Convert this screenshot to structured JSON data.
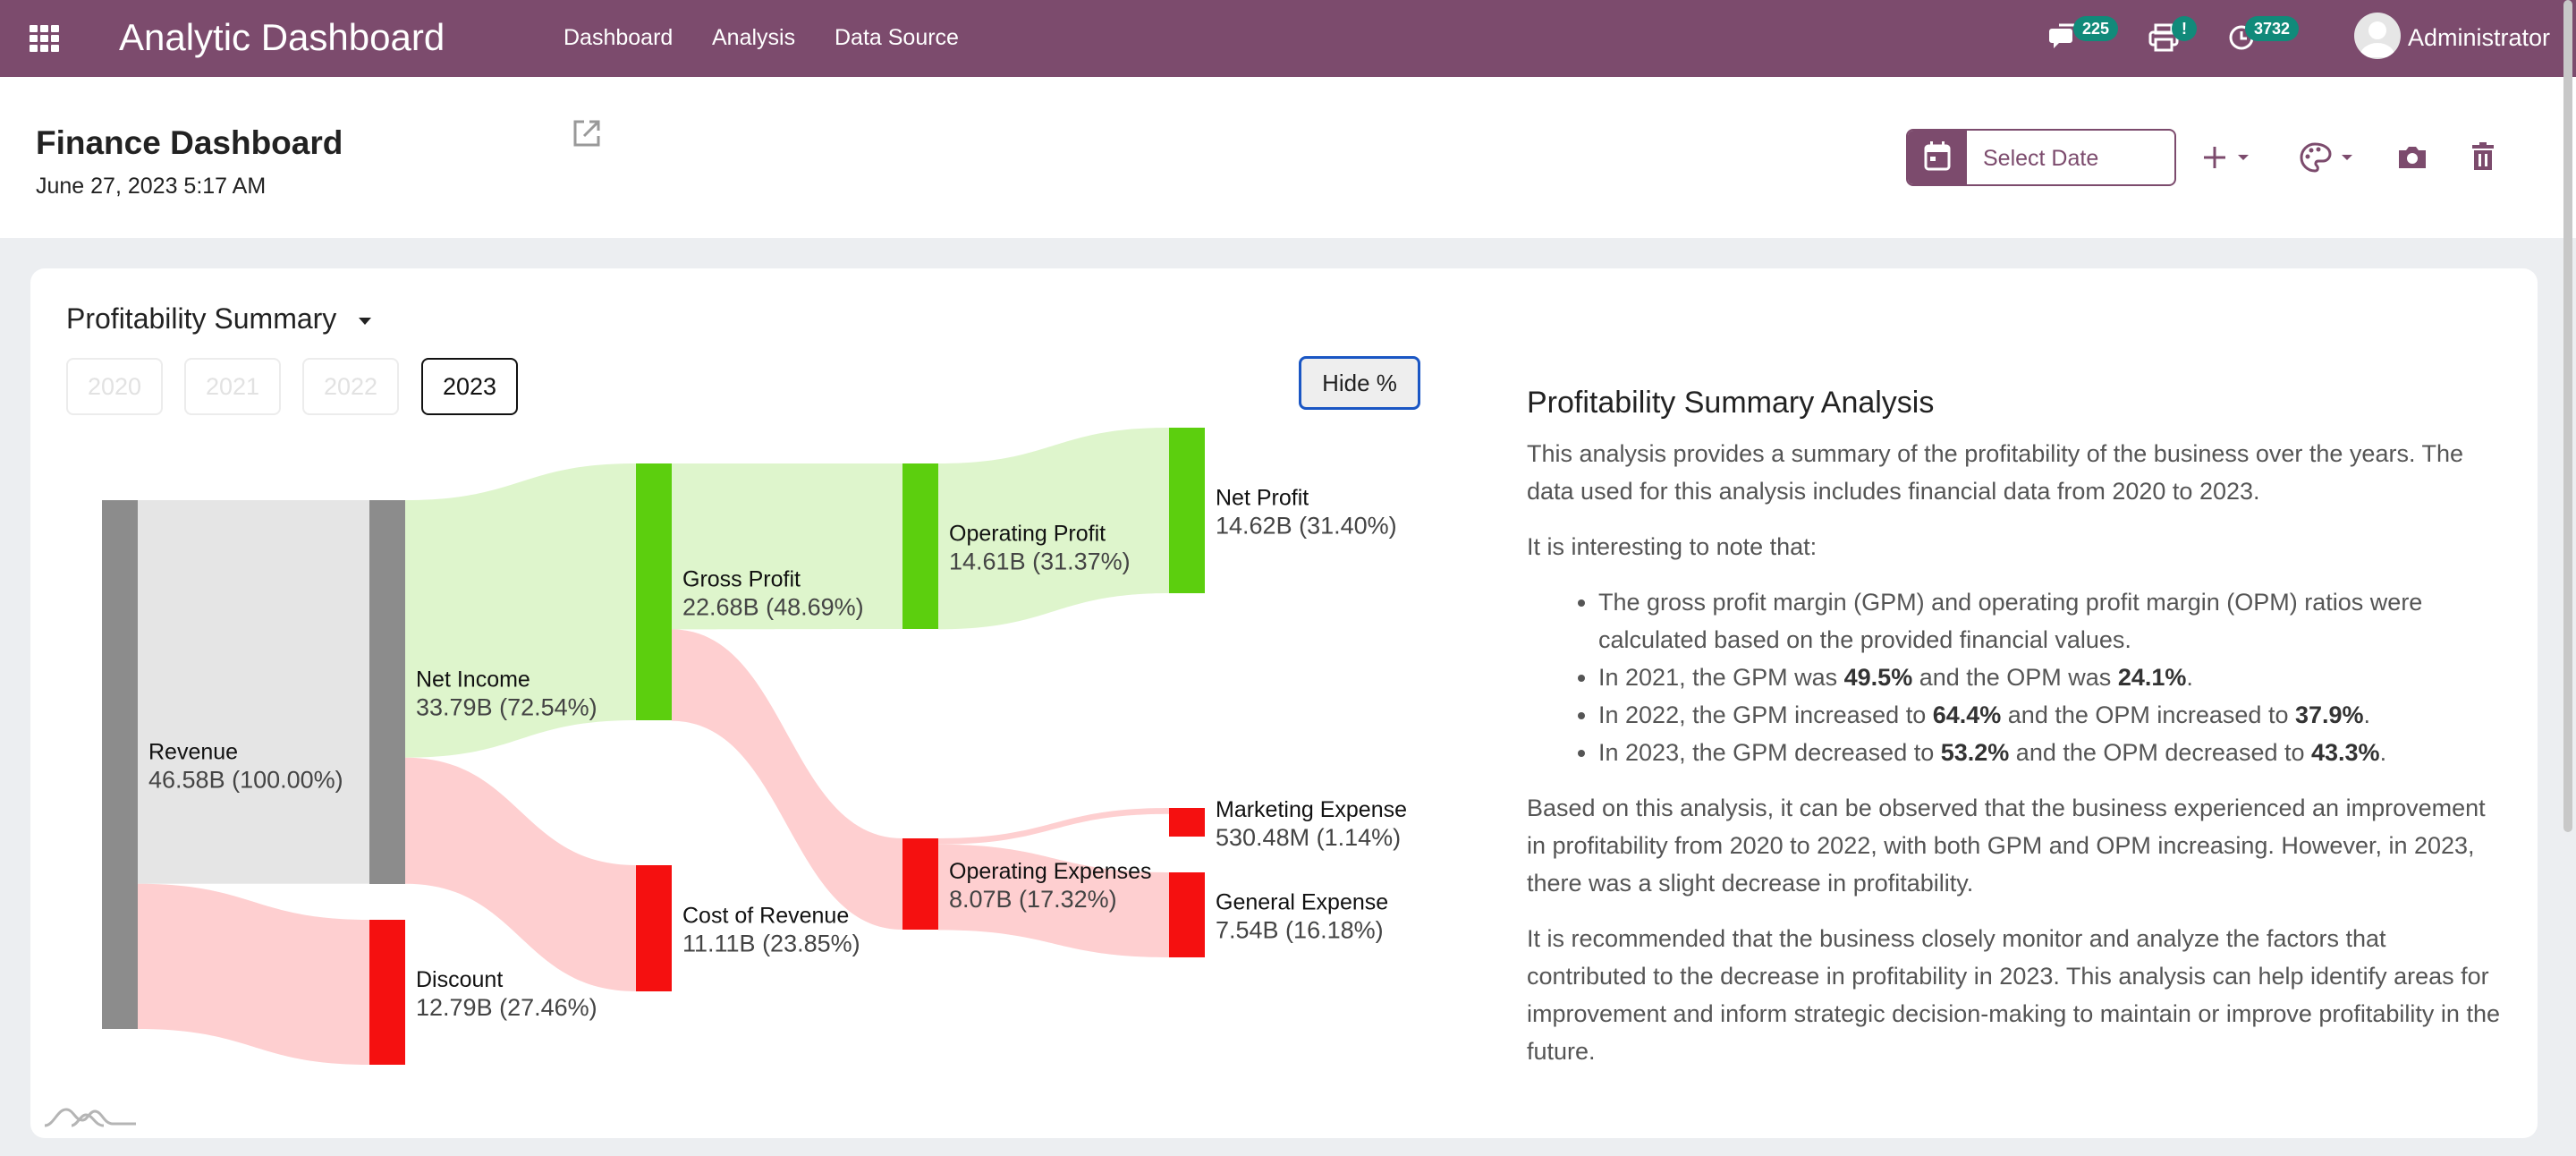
{
  "nav": {
    "title": "Analytic Dashboard",
    "items": [
      {
        "label": "Dashboard"
      },
      {
        "label": "Analysis"
      },
      {
        "label": "Data Source"
      }
    ],
    "badges": {
      "messages": "225",
      "printer": "!",
      "activity": "3732"
    },
    "user": "Administrator",
    "icons": [
      "apps-grid-icon",
      "chat-icon",
      "printer-icon",
      "clock-icon"
    ]
  },
  "header": {
    "title": "Finance Dashboard",
    "date": "June 27, 2023 5:17 AM",
    "date_placeholder": "Select Date",
    "icons": [
      "external-link-icon",
      "calendar-icon",
      "plus-icon",
      "palette-icon",
      "camera-icon",
      "trash-icon"
    ]
  },
  "card": {
    "selector": "Profitability Summary",
    "years": [
      {
        "label": "2020",
        "active": false
      },
      {
        "label": "2021",
        "active": false
      },
      {
        "label": "2022",
        "active": false
      },
      {
        "label": "2023",
        "active": true
      }
    ],
    "hide_label": "Hide %"
  },
  "chart_data": {
    "type": "sankey",
    "colors": {
      "neutral": "#8c8c8c",
      "profit": "#5ccf0e",
      "loss": "#f51010",
      "profit_link": "#def5cc",
      "loss_link": "#fecfd0",
      "neutral_link": "#e5e5e5"
    },
    "nodes": [
      {
        "id": "revenue",
        "label": "Revenue",
        "value": "46.58B (100.00%)"
      },
      {
        "id": "net_income",
        "label": "Net Income",
        "value": "33.79B (72.54%)"
      },
      {
        "id": "discount",
        "label": "Discount",
        "value": "12.79B (27.46%)"
      },
      {
        "id": "gross_profit",
        "label": "Gross Profit",
        "value": "22.68B (48.69%)"
      },
      {
        "id": "cost_of_revenue",
        "label": "Cost of Revenue",
        "value": "11.11B (23.85%)"
      },
      {
        "id": "operating_profit",
        "label": "Operating Profit",
        "value": "14.61B (31.37%)"
      },
      {
        "id": "operating_expenses",
        "label": "Operating Expenses",
        "value": "8.07B (17.32%)"
      },
      {
        "id": "net_profit",
        "label": "Net Profit",
        "value": "14.62B (31.40%)"
      },
      {
        "id": "marketing_expense",
        "label": "Marketing Expense",
        "value": "530.48M (1.14%)"
      },
      {
        "id": "general_expense",
        "label": "General Expense",
        "value": "7.54B (16.18%)"
      }
    ],
    "links": [
      {
        "source": "revenue",
        "target": "net_income",
        "value": 33.79
      },
      {
        "source": "revenue",
        "target": "discount",
        "value": 12.79
      },
      {
        "source": "net_income",
        "target": "gross_profit",
        "value": 22.68
      },
      {
        "source": "net_income",
        "target": "cost_of_revenue",
        "value": 11.11
      },
      {
        "source": "gross_profit",
        "target": "operating_profit",
        "value": 14.61
      },
      {
        "source": "gross_profit",
        "target": "operating_expenses",
        "value": 8.07
      },
      {
        "source": "operating_profit",
        "target": "net_profit",
        "value": 14.61
      },
      {
        "source": "operating_expenses",
        "target": "marketing_expense",
        "value": 0.53
      },
      {
        "source": "operating_expenses",
        "target": "general_expense",
        "value": 7.54
      }
    ]
  },
  "analysis": {
    "title": "Profitability Summary Analysis",
    "intro": "This analysis provides a summary of the profitability of the business over the years. The data used for this analysis includes financial data from 2020 to 2023.",
    "lead": "It is interesting to note that:",
    "bullets": [
      {
        "pre": "The gross profit margin (GPM) and operating profit margin (OPM) ratios were calculated based on the provided financial values."
      },
      {
        "pre": "In 2021, the GPM was ",
        "gpm": "49.5%",
        "mid": " and the OPM was ",
        "opm": "24.1%",
        "post": "."
      },
      {
        "pre": "In 2022, the GPM increased to ",
        "gpm": "64.4%",
        "mid": " and the OPM increased to ",
        "opm": "37.9%",
        "post": "."
      },
      {
        "pre": "In 2023, the GPM decreased to ",
        "gpm": "53.2%",
        "mid": " and the OPM decreased to ",
        "opm": "43.3%",
        "post": "."
      }
    ],
    "conclusion": "Based on this analysis, it can be observed that the business experienced an improvement in profitability from 2020 to 2022, with both GPM and OPM increasing. However, in 2023, there was a slight decrease in profitability.",
    "recommendation": "It is recommended that the business closely monitor and analyze the factors that contributed to the decrease in profitability in 2023. This analysis can help identify areas for improvement and inform strategic decision-making to maintain or improve profitability in the future."
  }
}
